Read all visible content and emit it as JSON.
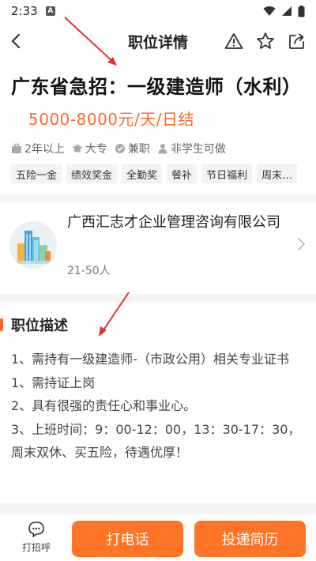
{
  "status_bar": {
    "time": "2:33",
    "notification_badge": "A"
  },
  "nav": {
    "title": "职位详情"
  },
  "job": {
    "title": "广东省急招：一级建造师（水利）",
    "salary": "5000-8000元/天/日结",
    "requirements": [
      {
        "icon": "briefcase-icon",
        "label": "2年以上"
      },
      {
        "icon": "graduation-cap-icon",
        "label": "大专"
      },
      {
        "icon": "part-time-icon",
        "label": "兼职"
      },
      {
        "icon": "person-icon",
        "label": "非学生可做"
      }
    ],
    "welfare": [
      "五险一金",
      "绩效奖金",
      "全勤奖",
      "餐补",
      "节日福利",
      "周末…"
    ]
  },
  "company": {
    "name": "广西汇志才企业管理咨询有限公司",
    "size": "21-50人"
  },
  "description": {
    "title": "职位描述",
    "lines": [
      "1、需持有一级建造师-（市政公用）相关专业证书",
      "1、需持证上岗",
      "2、具有很强的责任心和事业心。",
      "3、上班时间：9：00-12：00，13：30-17：30，周末双休、买五险，待遇优厚！"
    ]
  },
  "bottom": {
    "greet_label": "打招呼",
    "call_label": "打电话",
    "apply_label": "投递简历"
  },
  "colors": {
    "accent": "#ff7427",
    "salary": "#ff6a2a",
    "arrow": "#e53030"
  }
}
